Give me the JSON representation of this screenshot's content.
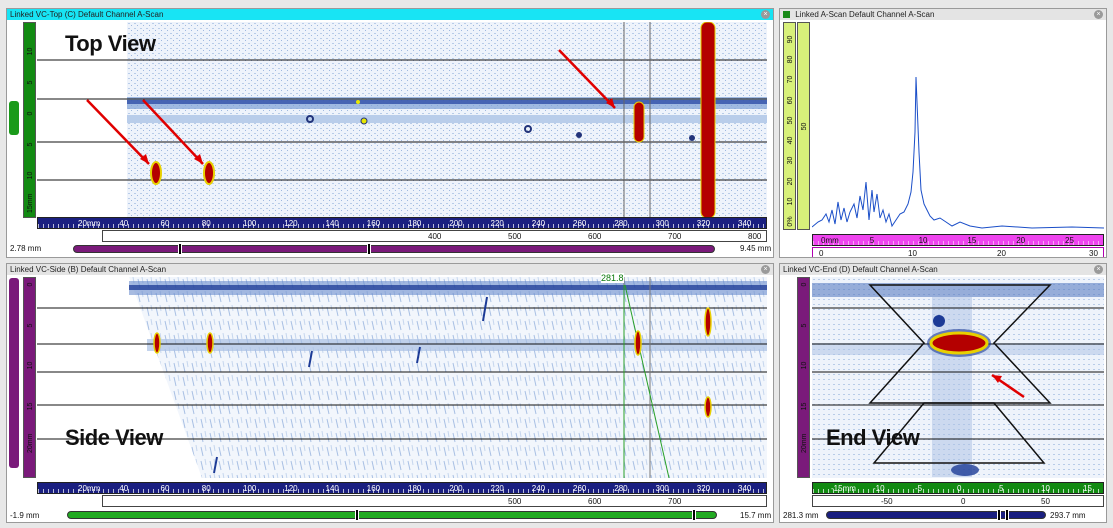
{
  "colors": {
    "active_title": "#18e4f4",
    "ruler_blue": "#1a1f80",
    "ruler_green": "#128a12",
    "ruler_magenta": "#ee44ee",
    "ruler_yellow": "#d8f07a",
    "ruler_purple": "#7a1a7a",
    "signal_red": "#b40000",
    "arrow_red": "#e00000"
  },
  "top_panel": {
    "title": "Linked VC-Top (C) Default Channel A-Scan",
    "overlay_label": "Top View",
    "vruler_labels": [
      "10",
      "5",
      "0",
      "5",
      "10",
      "15mm"
    ],
    "hruler_labels": [
      "20mm",
      "40",
      "60",
      "80",
      "100",
      "120",
      "140",
      "160",
      "180",
      "200",
      "220",
      "240",
      "260",
      "280",
      "300",
      "320",
      "340"
    ],
    "scale2_labels": [
      "400",
      "500",
      "600",
      "700",
      "800"
    ],
    "range_min": "2.78 mm",
    "range_max": "9.45 mm"
  },
  "ascan_panel": {
    "title": "Linked A-Scan Default Channel A-Scan",
    "vruler_labels": [
      "0%",
      "10",
      "20",
      "30",
      "40",
      "50",
      "60",
      "70",
      "80",
      "90"
    ],
    "vruler2_label": "50",
    "hruler_labels": [
      "0mm",
      "5",
      "10",
      "15",
      "20",
      "25"
    ],
    "scale2_labels": [
      "0",
      "10",
      "20"
    ],
    "scale2_end": "30"
  },
  "side_panel": {
    "title": "Linked VC-Side (B) Default Channel A-Scan",
    "overlay_label": "Side View",
    "cursor_value": "281.8",
    "vruler_labels": [
      "0",
      "5",
      "10",
      "15",
      "20mm"
    ],
    "hruler_labels": [
      "20mm",
      "40",
      "60",
      "80",
      "100",
      "120",
      "140",
      "160",
      "180",
      "200",
      "220",
      "240",
      "260",
      "280",
      "300",
      "320",
      "340"
    ],
    "scale2_labels": [
      "500",
      "600",
      "700"
    ],
    "range_min": "-1.9 mm",
    "range_max": "15.7 mm"
  },
  "end_panel": {
    "title": "Linked VC-End (D) Default Channel A-Scan",
    "overlay_label": "End View",
    "vruler_labels": [
      "0",
      "5",
      "10",
      "15",
      "20mm"
    ],
    "hruler_labels": [
      "-15mm",
      "-10",
      "-5",
      "0",
      "5",
      "10",
      "15"
    ],
    "scale2_labels": [
      "-50",
      "0",
      "50"
    ],
    "range_min": "281.3 mm",
    "range_max": "293.7 mm"
  }
}
